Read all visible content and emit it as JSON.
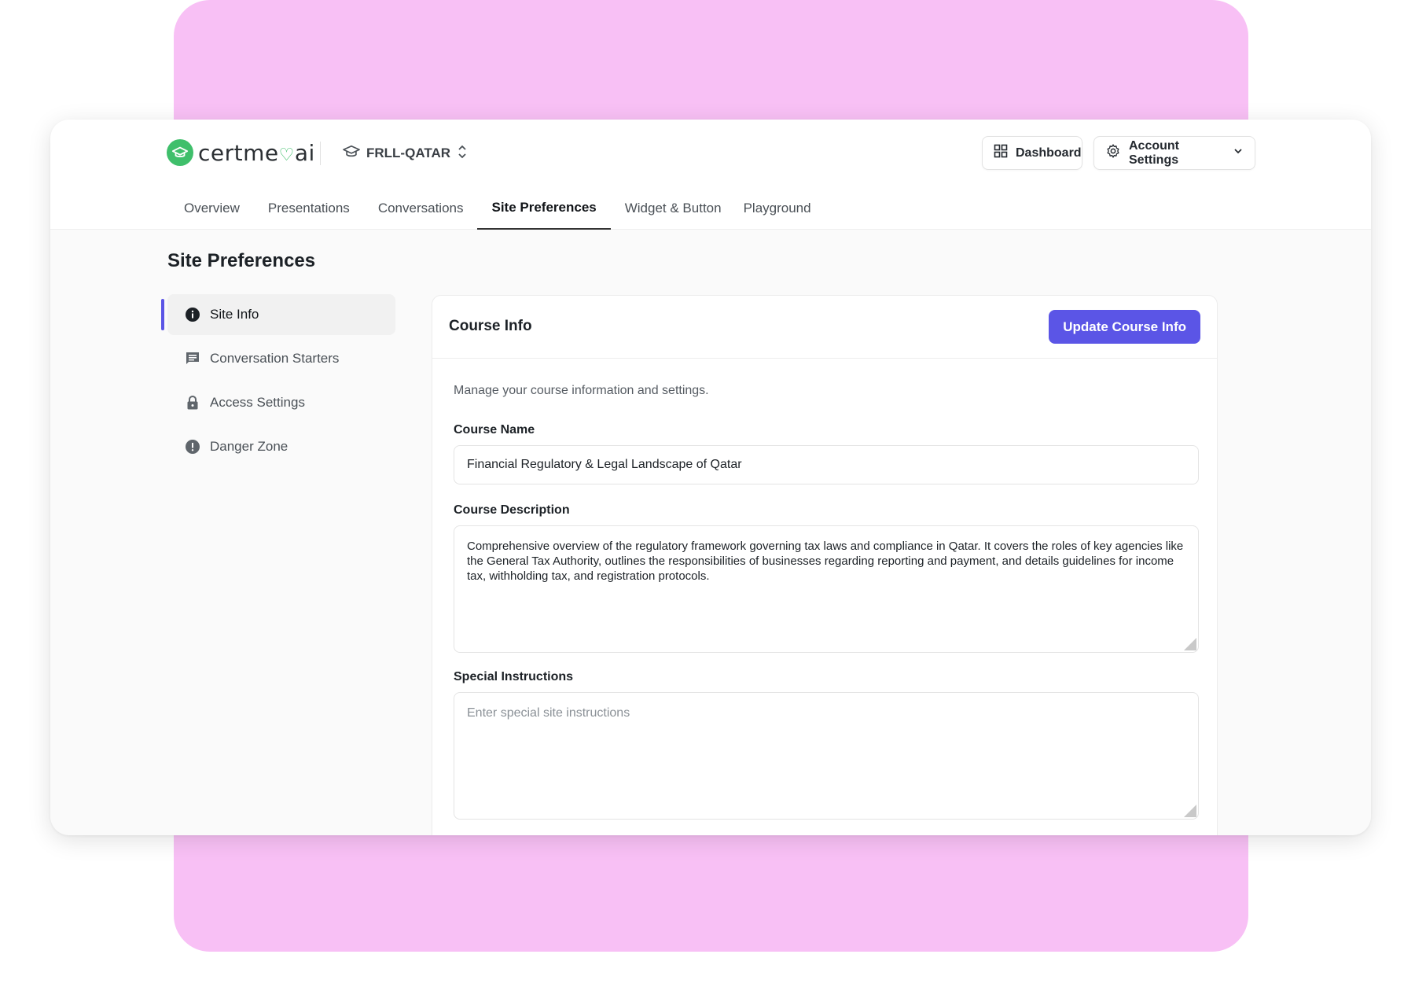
{
  "brand": {
    "name_prefix": "certme",
    "name_suffix": "ai",
    "heart": "♡"
  },
  "course_switcher": {
    "code": "FRLL-QATAR"
  },
  "header_buttons": {
    "dashboard_label": "Dashboard",
    "account_label": "Account Settings"
  },
  "tabs": [
    {
      "label": "Overview",
      "active": false
    },
    {
      "label": "Presentations",
      "active": false
    },
    {
      "label": "Conversations",
      "active": false
    },
    {
      "label": "Site Preferences",
      "active": true
    },
    {
      "label": "Widget & Button",
      "active": false
    },
    {
      "label": "Playground",
      "active": false
    }
  ],
  "page": {
    "title": "Site Preferences"
  },
  "sidebar": {
    "items": [
      {
        "label": "Site Info",
        "icon": "info-icon",
        "active": true
      },
      {
        "label": "Conversation Starters",
        "icon": "chat-icon",
        "active": false
      },
      {
        "label": "Access Settings",
        "icon": "lock-icon",
        "active": false
      },
      {
        "label": "Danger Zone",
        "icon": "alert-icon",
        "active": false
      }
    ]
  },
  "course_info": {
    "title": "Course Info",
    "update_button": "Update Course Info",
    "description": "Manage your course information and settings.",
    "name_label": "Course Name",
    "name_value": "Financial Regulatory & Legal Landscape of Qatar",
    "description_label": "Course Description",
    "description_value": "Comprehensive overview of the regulatory framework governing tax laws and compliance in Qatar. It covers the roles of key agencies like the General Tax Authority, outlines the responsibilities of businesses regarding reporting and payment, and details guidelines for income tax, withholding tax, and registration protocols.",
    "instructions_label": "Special Instructions",
    "instructions_placeholder": "Enter special site instructions"
  },
  "colors": {
    "accent": "#5b55e6",
    "brand_green": "#3fbf6b",
    "backdrop_pink": "#f8c0f5"
  }
}
